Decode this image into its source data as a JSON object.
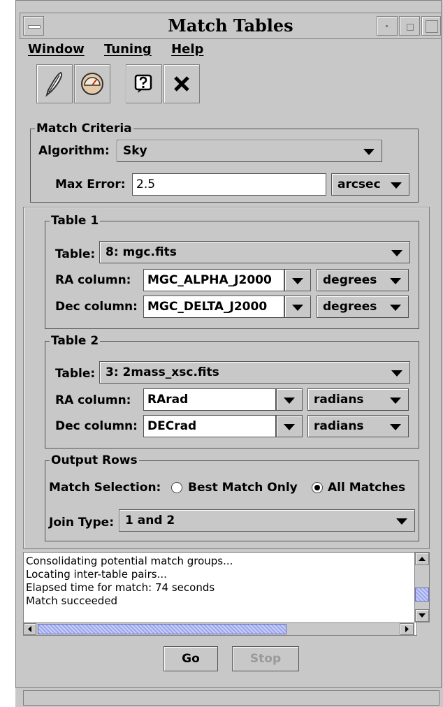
{
  "window": {
    "title": "Match Tables"
  },
  "menu": [
    "Window",
    "Tuning",
    "Help"
  ],
  "toolbar": {
    "icons": [
      "feather-icon",
      "gauge-icon",
      "help-icon",
      "close-icon"
    ]
  },
  "match_criteria": {
    "group_label": "Match Criteria",
    "algorithm_label": "Algorithm:",
    "algorithm_value": "Sky",
    "max_error_label": "Max Error:",
    "max_error_value": "2.5",
    "max_error_unit": "arcsec"
  },
  "table1": {
    "group_label": "Table 1",
    "table_label": "Table:",
    "table_value": "8: mgc.fits",
    "ra_label": "RA column:",
    "ra_value": "MGC_ALPHA_J2000",
    "ra_unit": "degrees",
    "dec_label": "Dec column:",
    "dec_value": "MGC_DELTA_J2000",
    "dec_unit": "degrees"
  },
  "table2": {
    "group_label": "Table 2",
    "table_label": "Table:",
    "table_value": "3: 2mass_xsc.fits",
    "ra_label": "RA column:",
    "ra_value": "RArad",
    "ra_unit": "radians",
    "dec_label": "Dec column:",
    "dec_value": "DECrad",
    "dec_unit": "radians"
  },
  "output_rows": {
    "group_label": "Output Rows",
    "selection_label": "Match Selection:",
    "option_best": "Best Match Only",
    "option_all": "All Matches",
    "selected": "All Matches",
    "join_label": "Join Type:",
    "join_value": "1 and 2"
  },
  "log": [
    "Consolidating potential match groups...",
    "Locating inter-table pairs...",
    "Elapsed time for match: 74 seconds",
    "Match succeeded"
  ],
  "buttons": {
    "go": "Go",
    "stop": "Stop"
  }
}
